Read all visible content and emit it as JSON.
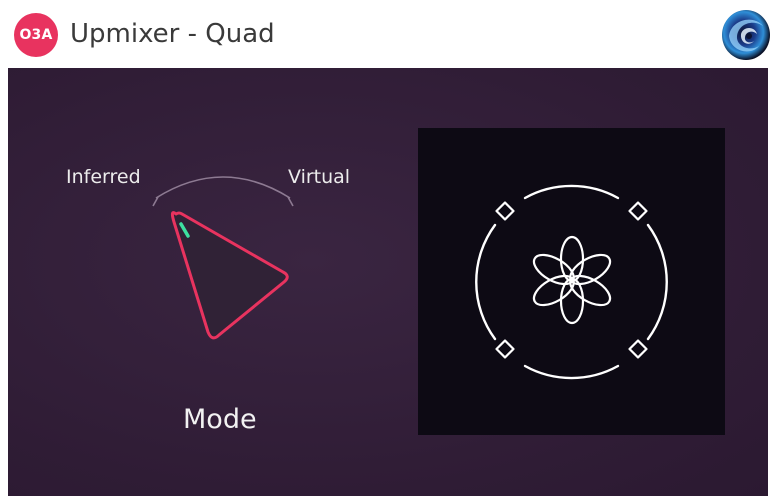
{
  "window": {
    "badge_text": "O3A",
    "title": "Upmixer - Quad",
    "logo_icon": "o3a-swirl-logo-icon"
  },
  "colors": {
    "badge": "#e8335f",
    "panel_bg": "#34203a",
    "knob_outline": "#e8335f",
    "knob_indicator": "#3de0a0",
    "display_bg": "#0d0a14"
  },
  "mode_knob": {
    "label": "Mode",
    "left_label": "Inferred",
    "right_label": "Virtual",
    "value_fraction": 0.0
  },
  "speaker_display": {
    "icon": "quad-speaker-layout-icon",
    "speakers": 4
  }
}
